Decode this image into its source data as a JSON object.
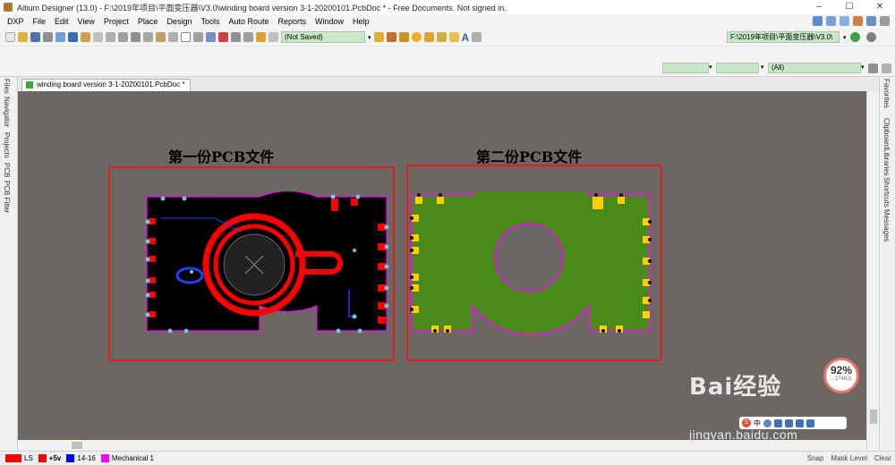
{
  "window": {
    "title": "Altium Designer (13.0) - F:\\2019年项目\\平面变压器\\V3.0\\winding board version 3-1-20200101.PcbDoc * - Free Documents. Not signed in.",
    "buttons": [
      "–",
      "☐",
      "✕"
    ]
  },
  "menu": [
    "DXP",
    "File",
    "Edit",
    "View",
    "Project",
    "Place",
    "Design",
    "Tools",
    "Auto Route",
    "Reports",
    "Window",
    "Help"
  ],
  "toolbar": {
    "save_state": "(Not Saved)",
    "project_path": "F:\\2019年项目\\平面变压器\\V3.0\\"
  },
  "filter": {
    "value": "(All)"
  },
  "left_panels": [
    "Files",
    "Navigator",
    "Projects",
    "PCB",
    "PCB Filter"
  ],
  "right_panels": [
    "Favorites",
    "Clipboard",
    "Libraries",
    "Shortcuts",
    "Messages"
  ],
  "document_tab": "winding board version 3-1-20200101.PcbDoc *",
  "canvas": {
    "heading_left": "第一份PCB文件",
    "heading_right": "第二份PCB文件"
  },
  "status": {
    "layers": [
      {
        "label": "LS",
        "color": "#ff0000"
      },
      {
        "label": "+5v",
        "color": "#ff0000"
      },
      {
        "label": "14-16",
        "color": "#0000ff"
      },
      {
        "label": "Mechanical 1",
        "color": "#ff00ff"
      }
    ],
    "right": [
      "Snap",
      "Mask Level",
      "Clear"
    ]
  },
  "overlay": {
    "percent": "92%",
    "speed": "↓ 274K/s",
    "watermark": "Bai经验",
    "watermark_url": "jingyan.baidu.com",
    "ime_label": "中"
  },
  "colors": {
    "canvas_bg": "#6d6764",
    "copper_top": "#ff0000",
    "board_green": "#4a8a1a",
    "pad_yellow": "#ffd000",
    "outline_magenta": "#ff00ff",
    "highlight_box": "#e02020"
  }
}
